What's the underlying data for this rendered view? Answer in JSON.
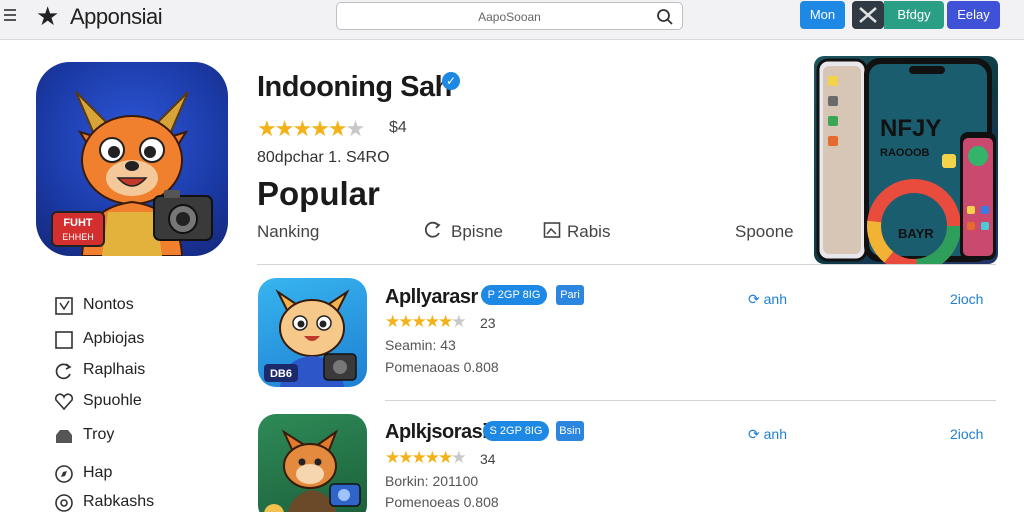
{
  "header": {
    "app_title": "Apponsiai",
    "search_placeholder": "AapoSooan",
    "buttons": [
      "Mon",
      "",
      "Bfdgy",
      "Eelay"
    ]
  },
  "featured": {
    "title": "Indooning Sah",
    "rating": "$4",
    "stars": 4.5,
    "meta": "80dpchar 1. S4RO",
    "category": "Popular",
    "tabs": [
      "Nanking",
      "Bpisne",
      "Rabis",
      "Spoone"
    ],
    "badge_text_1": "FUHT",
    "badge_text_2": "EHHEH"
  },
  "promo": {
    "headline_1": "NFJY",
    "headline_2": "RAOOOB",
    "footer": "BAYR"
  },
  "sidebar": {
    "items": [
      {
        "label": "Nontos",
        "icon": "edit-square-icon"
      },
      {
        "label": "Apbiojas",
        "icon": "square-icon"
      },
      {
        "label": "Raplhais",
        "icon": "refresh-icon"
      },
      {
        "label": "Spuohle",
        "icon": "heart-icon"
      },
      {
        "label": "Troy",
        "icon": "folder-icon"
      },
      {
        "label": "Hap",
        "icon": "compass-icon"
      },
      {
        "label": "Rabkashs",
        "icon": "settings-icon"
      }
    ]
  },
  "list": [
    {
      "name": "Apllyarasr",
      "pill": "P 2GP 8IG",
      "tag": "Pari",
      "stars": 4.5,
      "rating": "23",
      "line1": "Seamin: 43",
      "line2": "Pomenaoas 0.808",
      "link1": "⟳ anh",
      "link2": "2ioch",
      "badge": "DB6"
    },
    {
      "name": "Aplkjsorasi",
      "pill": "S 2GP 8IG",
      "tag": "Bsin",
      "stars": 4.5,
      "rating": "34",
      "line1": "Borkin: 201100",
      "line2": "Pomenoeas 0.808",
      "link1": "⟳ anh",
      "link2": "2ioch",
      "badge": ""
    }
  ],
  "colors": {
    "accent_blue": "#1e88e5",
    "star_gold": "#f3b21a",
    "topbar_bg": "#f2f2f4"
  }
}
